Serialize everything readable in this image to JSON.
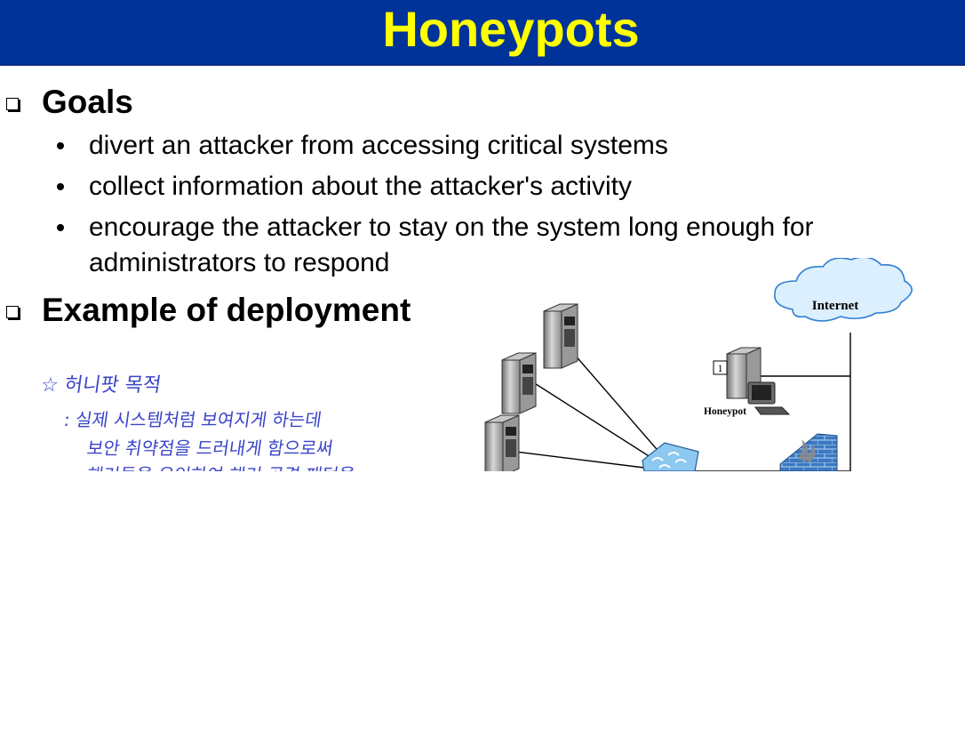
{
  "slide": {
    "title": "Honeypots",
    "sections": [
      {
        "heading": "Goals",
        "bullets": [
          "divert an attacker from accessing critical systems",
          "collect information about the attacker's activity",
          "encourage the attacker to stay on the system long enough for",
          "administrators to respond"
        ]
      },
      {
        "heading": "Example of deployment"
      }
    ],
    "handwritten_note": {
      "line1": "☆ 허니팟 목적",
      "line2": ": 실제 시스템처럼 보여지게 하는데",
      "line3": "보안 취약점을 드러내게 함으로써",
      "line4": "해커들을 유인하여 해커 공격 패턴을"
    },
    "diagram": {
      "internet_label": "Internet",
      "honeypot_label": "Honeypot",
      "marker_label": "1"
    }
  },
  "colors": {
    "title_bar": "#003399",
    "title_text": "#ffff00",
    "handwriting": "#3a45c8",
    "cloud_fill": "#dcefff",
    "cloud_stroke": "#2f7fd0"
  }
}
